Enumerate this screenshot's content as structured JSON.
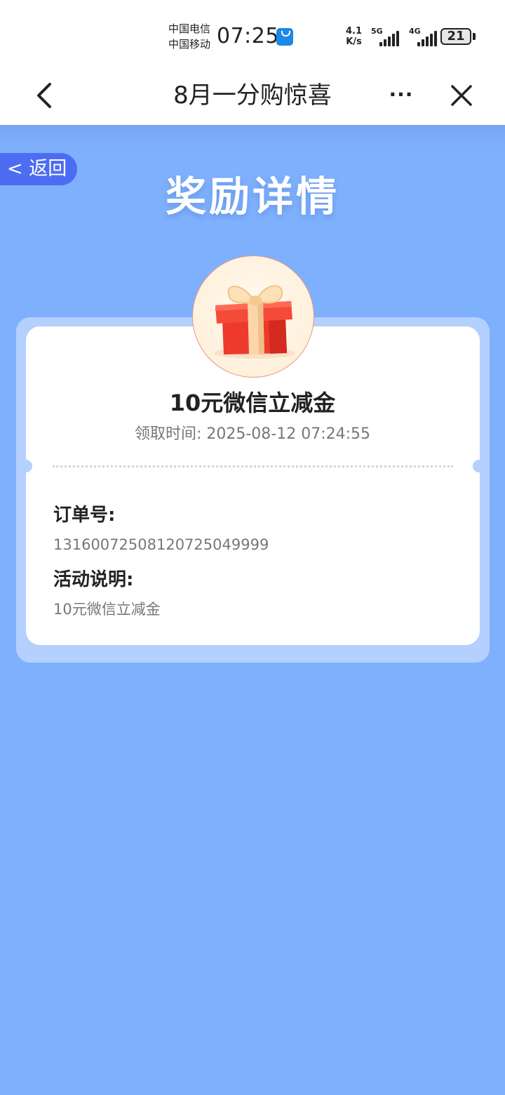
{
  "status_bar": {
    "carrier_1": "中国电信",
    "carrier_2": "中国移动",
    "time": "07:25",
    "net_speed_value": "4.1",
    "net_speed_unit": "K/s",
    "signal_1_label": "5G",
    "signal_2_label": "4G",
    "battery": "21"
  },
  "nav": {
    "title": "8月一分购惊喜",
    "more": "···"
  },
  "back_button": "< 返回",
  "page_title": "奖励详情",
  "reward": {
    "name": "10元微信立减金",
    "claim_time_label": "领取时间:",
    "claim_time_value": "2025-08-12 07:24:55"
  },
  "details": {
    "order_label": "订单号:",
    "order_value": "1316007250812072504999​9",
    "activity_label": "活动说明:",
    "activity_value": "10元微信立减金"
  },
  "colors": {
    "page_background": "#7fb0fd",
    "card_frame": "#b3d0fe",
    "back_pill": "#4c6df2",
    "gift_box": "#f23b2e"
  }
}
